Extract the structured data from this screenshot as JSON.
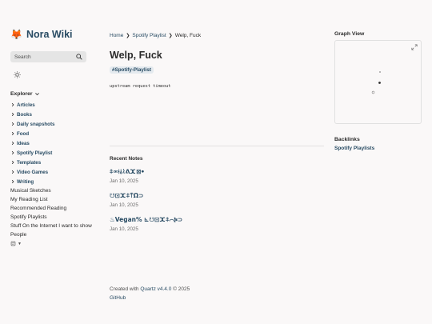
{
  "brand": {
    "logo": "🦊",
    "title": "Nora Wiki"
  },
  "search": {
    "placeholder": "Search",
    "icon": "search-icon"
  },
  "theme": {
    "icon": "sun-icon"
  },
  "explorer": {
    "title": "Explorer",
    "folders": [
      "Articles",
      "Books",
      "Daily snapshots",
      "Food",
      "Ideas",
      "Spotify Playlist",
      "Templates",
      "Video Games",
      "Writing"
    ],
    "files": [
      "Musical Sketches",
      "My Reading List",
      "Recommended Reading",
      "Spotify Playlists",
      "Stuff On the Internet I want to show People"
    ]
  },
  "breadcrumb": {
    "home": "Home",
    "section": "Spotify Playlist",
    "current": "Welp, Fuck"
  },
  "article": {
    "title": "Welp, Fuck",
    "tag": "#Spotify-Playlist",
    "body": "upstream request timeout"
  },
  "recent": {
    "heading": "Recent Notes",
    "notes": [
      {
        "title": "⍏⚮⍿⫰⌇ᕕⵋ⊠ꔷ",
        "date": "Jan 10, 2025"
      },
      {
        "title": "☋⊡ⵋ⍏⍑Ω⊃",
        "date": "Jan 10, 2025"
      },
      {
        "title": "♨Vegan% ⊾☋⊡ⵋ⍏⌒Ⰽ⊃",
        "date": "Jan 10, 2025"
      }
    ]
  },
  "footer": {
    "created_prefix": "Created with",
    "quartz": "Quartz v4.4.0",
    "year": "© 2025",
    "github": "GitHub"
  },
  "graph": {
    "title": "Graph View",
    "expand_icon": "expand-icon"
  },
  "backlinks": {
    "title": "Backlinks",
    "items": [
      "Spotify Playlists"
    ]
  },
  "colors": {
    "accent": "#284b63",
    "background": "#faf8f8",
    "text": "#2b2b2b"
  }
}
